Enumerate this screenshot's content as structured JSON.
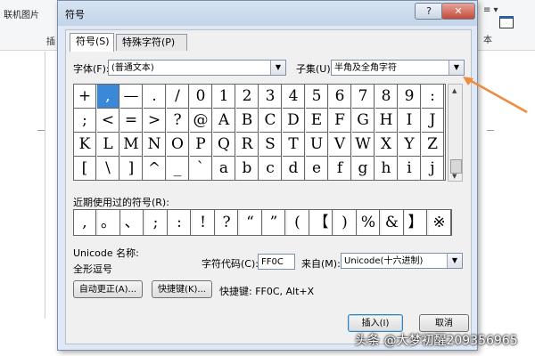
{
  "background": {
    "left_label": "联机图片",
    "left_label2": "插",
    "right_label": "≡ ▾",
    "right_label2": "本"
  },
  "dialog": {
    "title": "符号",
    "help_label": "?",
    "close_label": "✕",
    "tabs": [
      {
        "label": "符号(S)",
        "active": true
      },
      {
        "label": "特殊字符(P)",
        "active": false
      }
    ],
    "font_label": "字体(F):",
    "font_value": "(普通文本)",
    "subset_label": "子集(U):",
    "subset_value": "半角及全角字符",
    "grid_rows": [
      [
        "+",
        ",",
        "—",
        ".",
        "/",
        "0",
        "1",
        "2",
        "3",
        "4",
        "5",
        "6",
        "7",
        "8",
        "9",
        ":"
      ],
      [
        ";",
        "<",
        "=",
        ">",
        "?",
        "@",
        "A",
        "B",
        "C",
        "D",
        "E",
        "F",
        "G",
        "H",
        "I",
        "J"
      ],
      [
        "K",
        "L",
        "M",
        "N",
        "O",
        "P",
        "Q",
        "R",
        "S",
        "T",
        "U",
        "V",
        "W",
        "X",
        "Y",
        "Z"
      ],
      [
        "[",
        "\\",
        "]",
        "^",
        "_",
        "`",
        "a",
        "b",
        "c",
        "d",
        "e",
        "f",
        "g",
        "h",
        "i",
        "j"
      ]
    ],
    "selected_index": [
      0,
      1
    ],
    "recent_label": "近期使用过的符号(R):",
    "recent_symbols": [
      ",",
      "。",
      "、",
      ";",
      ":",
      "!",
      "?",
      "“",
      "”",
      "(",
      "【",
      ")",
      "%",
      "&",
      "】",
      "※"
    ],
    "unicode_name_label": "Unicode 名称:",
    "unicode_name_value": "全形逗号",
    "char_code_label": "字符代码(C):",
    "char_code_value": "FF0C",
    "from_label": "来自(M):",
    "from_value": "Unicode(十六进制)",
    "autocorrect_button": "自动更正(A)...",
    "shortcut_button": "快捷键(K)...",
    "shortcut_text": "快捷键: FF0C, Alt+X",
    "insert_button": "插入(I)",
    "cancel_button": "取消"
  },
  "colors": {
    "annotation_arrow": "#f08a3c",
    "selection": "#3b87d8"
  },
  "watermark": "头条 @大梦初醒209356965"
}
